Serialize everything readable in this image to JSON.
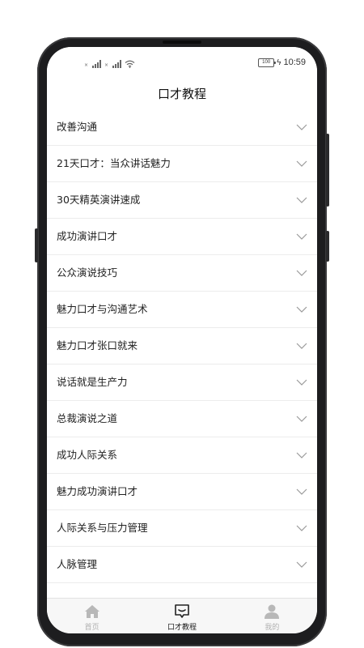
{
  "status_bar": {
    "time": "10:59",
    "battery_level": "100",
    "charging": true
  },
  "header": {
    "title": "口才教程"
  },
  "list": {
    "items": [
      {
        "label": "改善沟通"
      },
      {
        "label": "21天口才：当众讲话魅力"
      },
      {
        "label": "30天精英演讲速成"
      },
      {
        "label": "成功演讲口才"
      },
      {
        "label": "公众演说技巧"
      },
      {
        "label": "魅力口才与沟通艺术"
      },
      {
        "label": "魅力口才张口就来"
      },
      {
        "label": "说话就是生产力"
      },
      {
        "label": "总裁演说之道"
      },
      {
        "label": "成功人际关系"
      },
      {
        "label": "魅力成功演讲口才"
      },
      {
        "label": "人际关系与压力管理"
      },
      {
        "label": "人脉管理"
      }
    ],
    "chevron_icon": "chevron-down-icon"
  },
  "tabbar": {
    "tabs": [
      {
        "label": "首页",
        "icon": "home-icon",
        "active": false
      },
      {
        "label": "口才教程",
        "icon": "chat-icon",
        "active": true
      },
      {
        "label": "我的",
        "icon": "user-icon",
        "active": false
      }
    ]
  },
  "colors": {
    "active_tab": "#222222",
    "inactive_tab": "#b0b0b0",
    "list_text": "#222222",
    "divider": "#ececec",
    "chevron": "#9a9a9a"
  }
}
